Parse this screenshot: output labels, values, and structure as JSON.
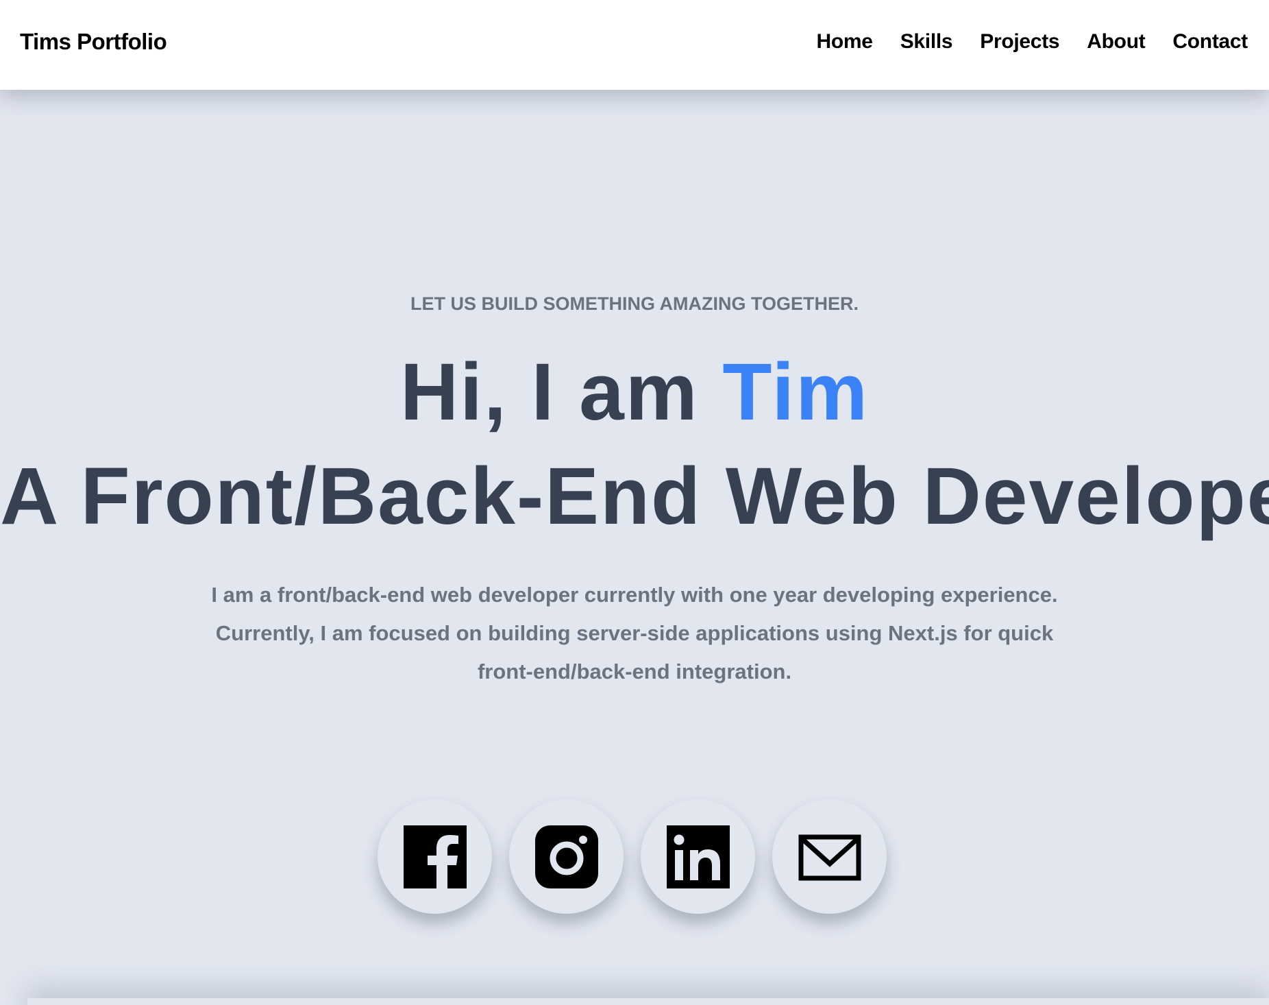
{
  "brand": "Tims Portfolio",
  "nav": {
    "items": [
      "Home",
      "Skills",
      "Projects",
      "About",
      "Contact"
    ]
  },
  "hero": {
    "tagline": "LET US BUILD SOMETHING AMAZING TOGETHER.",
    "greeting_prefix": "Hi, I am ",
    "name": "Tim",
    "role": "A Front/Back-End Web Developer",
    "bio": "I am a front/back-end web developer currently with one year developing experience. Currently, I am focused on building server-side applications using Next.js for quick front-end/back-end integration."
  },
  "social": {
    "icons": [
      "facebook-icon",
      "instagram-icon",
      "linkedin-icon",
      "mail-icon"
    ]
  },
  "colors": {
    "background": "#e1e6ef",
    "navbar": "#ffffff",
    "heading": "#374151",
    "accent": "#3b82f6",
    "muted_text": "#6b7280"
  }
}
